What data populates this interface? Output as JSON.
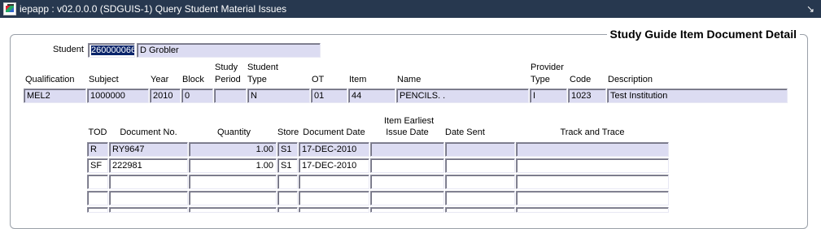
{
  "window": {
    "title": "iepapp : v02.0.0.0 (SDGUIS-1) Query Student Material Issues",
    "restore_icon": "restore-down-icon"
  },
  "section_title": "Study Guide Item Document Detail",
  "student": {
    "label": "Student",
    "number": "260000066",
    "name": "D Grobler"
  },
  "detail": {
    "headers": {
      "qualification": "Qualification",
      "subject": "Subject",
      "year": "Year",
      "block": "Block",
      "study_period_1": "Study",
      "study_period_2": "Period",
      "student_type_1": "Student",
      "student_type_2": "Type",
      "ot": "OT",
      "item": "Item",
      "name": "Name",
      "provider_type_1": "Provider",
      "provider_type_2": "Type",
      "code": "Code",
      "description": "Description"
    },
    "values": {
      "qualification": "MEL2",
      "subject": "1000000",
      "year": "2010",
      "block": "0",
      "study_period": "",
      "student_type": "N",
      "ot": "01",
      "item": "44",
      "name": "PENCILS. .",
      "provider_type": "I",
      "code": "1023",
      "description": "Test Institution"
    }
  },
  "documents": {
    "headers": {
      "tod": "TOD",
      "document_no": "Document No.",
      "quantity": "Quantity",
      "store": "Store",
      "document_date": "Document Date",
      "issue_date_1": "Item Earliest",
      "issue_date_2": "Issue Date",
      "date_sent": "Date Sent",
      "track_and_trace": "Track and Trace"
    },
    "rows": [
      {
        "tod": "R",
        "document_no": "RY9647",
        "quantity": "1.00",
        "store": "S1",
        "document_date": "17-DEC-2010",
        "issue_date": "",
        "date_sent": "",
        "track": ""
      },
      {
        "tod": "SF",
        "document_no": "222981",
        "quantity": "1.00",
        "store": "S1",
        "document_date": "17-DEC-2010",
        "issue_date": "",
        "date_sent": "",
        "track": ""
      },
      {
        "tod": "",
        "document_no": "",
        "quantity": "",
        "store": "",
        "document_date": "",
        "issue_date": "",
        "date_sent": "",
        "track": ""
      },
      {
        "tod": "",
        "document_no": "",
        "quantity": "",
        "store": "",
        "document_date": "",
        "issue_date": "",
        "date_sent": "",
        "track": ""
      },
      {
        "tod": "",
        "document_no": "",
        "quantity": "",
        "store": "",
        "document_date": "",
        "issue_date": "",
        "date_sent": "",
        "track": ""
      }
    ]
  }
}
